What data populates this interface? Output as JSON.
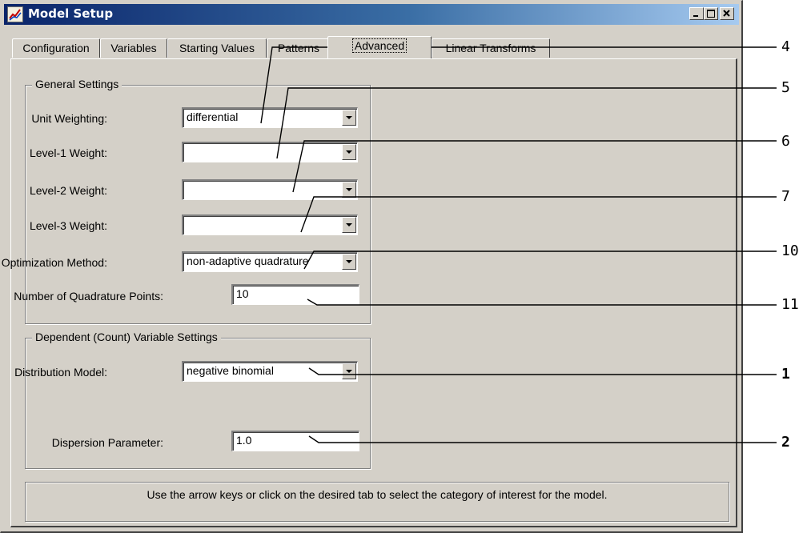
{
  "window": {
    "title": "Model Setup",
    "icon": "model-setup-app-icon"
  },
  "tabs": [
    {
      "label": "Configuration",
      "active": false
    },
    {
      "label": "Variables",
      "active": false
    },
    {
      "label": "Starting Values",
      "active": false
    },
    {
      "label": "Patterns",
      "active": false
    },
    {
      "label": "Advanced",
      "active": true
    },
    {
      "label": "Linear Transforms",
      "active": false
    }
  ],
  "general_settings": {
    "legend": "General Settings",
    "unit_weighting": {
      "label": "Unit Weighting:",
      "value": "differential"
    },
    "level1_weight": {
      "label": "Level-1 Weight:",
      "value": ""
    },
    "level2_weight": {
      "label": "Level-2 Weight:",
      "value": ""
    },
    "level3_weight": {
      "label": "Level-3 Weight:",
      "value": ""
    },
    "optimization_method": {
      "label": "Optimization Method:",
      "value": "non-adaptive quadrature"
    },
    "quadrature_points": {
      "label": "Number of Quadrature Points:",
      "value": "10"
    }
  },
  "dependent_settings": {
    "legend": "Dependent (Count) Variable Settings",
    "distribution_model": {
      "label": "Distribution Model:",
      "value": "negative binomial"
    },
    "dispersion_parameter": {
      "label": "Dispersion Parameter:",
      "value": "1.0"
    }
  },
  "status": {
    "text": "Use the arrow keys or click on the desired tab to select the category of interest for the model."
  },
  "callouts": [
    {
      "number": "4",
      "bold": false
    },
    {
      "number": "5",
      "bold": false
    },
    {
      "number": "6",
      "bold": false
    },
    {
      "number": "7",
      "bold": false
    },
    {
      "number": "10",
      "bold": false
    },
    {
      "number": "11",
      "bold": false
    },
    {
      "number": "1",
      "bold": true
    },
    {
      "number": "2",
      "bold": true
    }
  ]
}
